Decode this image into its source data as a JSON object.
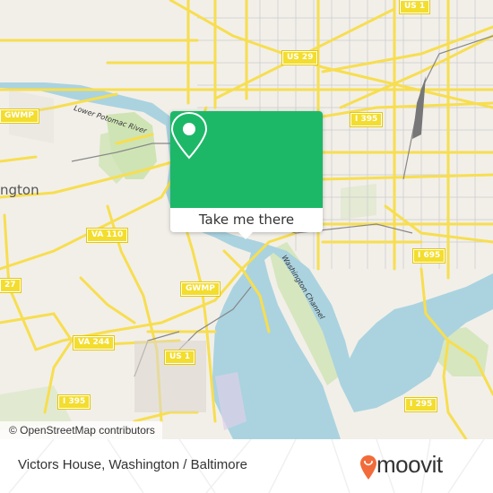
{
  "map": {
    "place_labels": [
      {
        "id": "arlington",
        "text": "ngton"
      }
    ],
    "water_labels": [
      {
        "id": "lower-potomac",
        "text": "Lower Potomac River"
      },
      {
        "id": "washington-channel",
        "text": "Washington Channel"
      }
    ],
    "route_shields": [
      {
        "id": "gwmp-north",
        "text": "GWMP"
      },
      {
        "id": "us-29",
        "text": "US 29"
      },
      {
        "id": "us-1-north",
        "text": "US 1"
      },
      {
        "id": "i395-north",
        "text": "I 395"
      },
      {
        "id": "va-110",
        "text": "VA 110"
      },
      {
        "id": "va-27",
        "text": "27"
      },
      {
        "id": "gwmp-south",
        "text": "GWMP"
      },
      {
        "id": "va-244",
        "text": "VA 244"
      },
      {
        "id": "us-1-south",
        "text": "US 1"
      },
      {
        "id": "i395-south",
        "text": "I 395"
      },
      {
        "id": "i695",
        "text": "I 695"
      },
      {
        "id": "i295",
        "text": "I 295"
      }
    ],
    "attribution": "© OpenStreetMap contributors"
  },
  "popup": {
    "icon": "map-pin-icon",
    "button_label": "Take me there",
    "color": "#1cb868"
  },
  "footer": {
    "title": "Victors House, Washington / Baltimore",
    "brand": "moovit",
    "brand_color": "#f26b3a"
  }
}
